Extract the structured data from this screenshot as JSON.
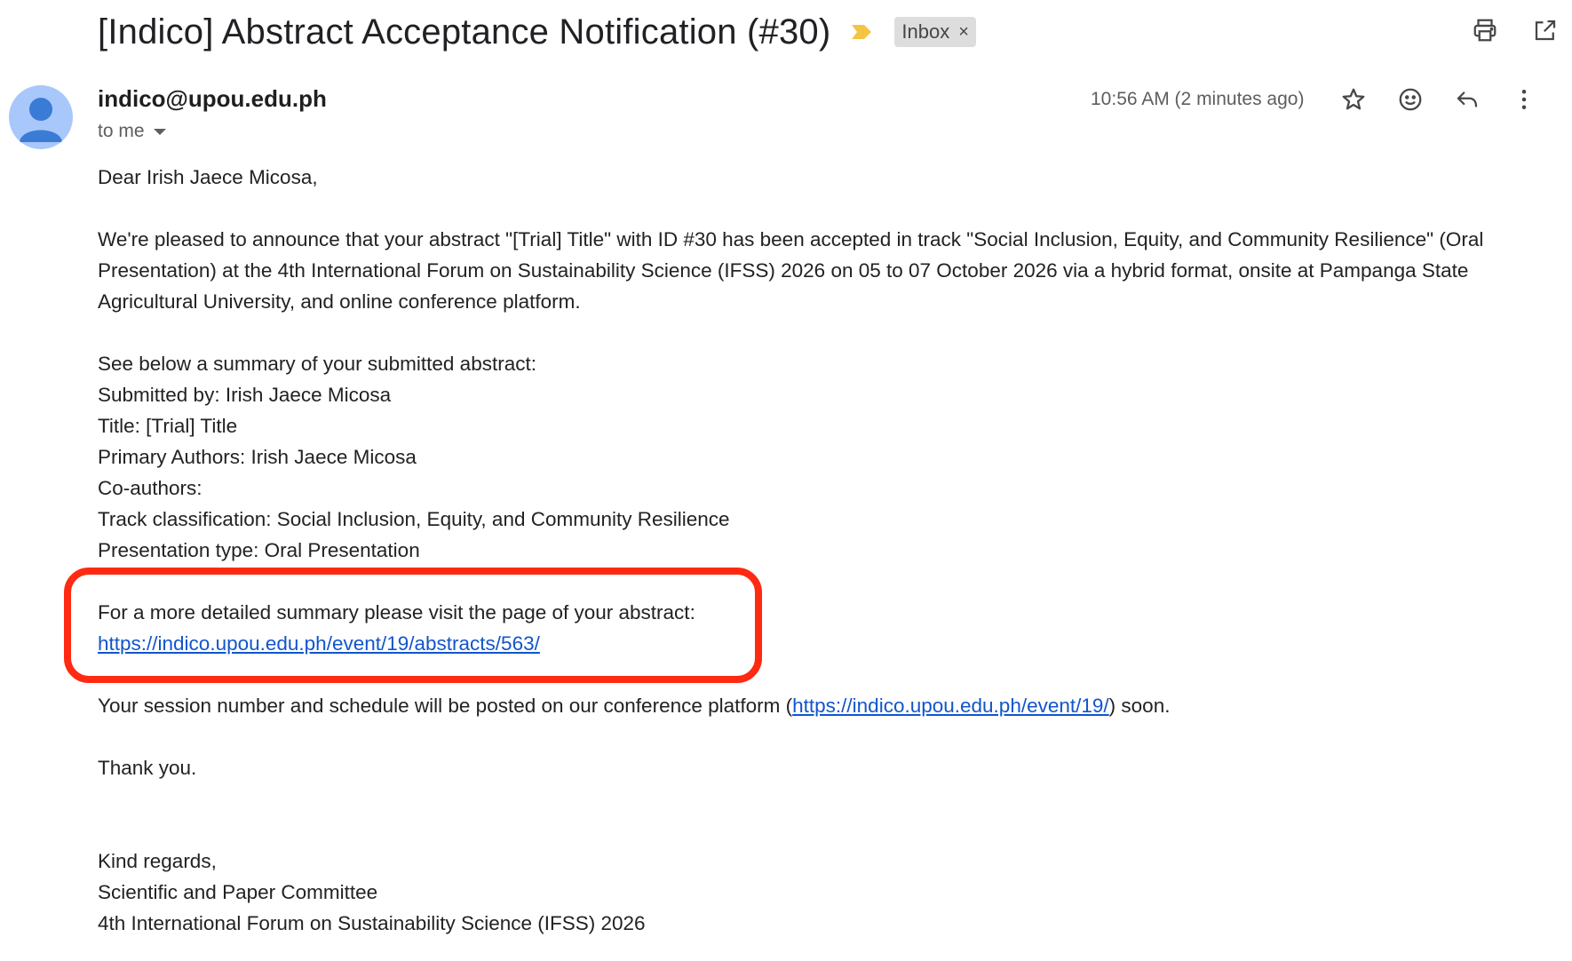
{
  "email": {
    "subject": "[Indico] Abstract Acceptance Notification (#30)",
    "label": "Inbox",
    "label_close": "×",
    "sender": "indico@upou.edu.ph",
    "recipient_line": "to me",
    "timestamp": "10:56 AM (2 minutes ago)"
  },
  "icons": {
    "importance": "importance-marker-icon",
    "print": "print-icon",
    "open_new_window": "open-in-new-window-icon",
    "star": "star-icon",
    "emoji": "emoji-reaction-icon",
    "reply": "reply-icon",
    "more": "more-vertical-icon",
    "avatar": "default-avatar-icon"
  },
  "colors": {
    "importance": "#f4c542",
    "highlight": "#ff2a12",
    "link": "#1155cc",
    "avatar_bg": "#a8c7fa",
    "avatar_fg": "#3a7bd5",
    "chip_bg": "#dddddd"
  },
  "body": {
    "greeting": "Dear Irish Jaece Micosa,",
    "intro": "We're pleased to announce that your abstract \"[Trial] Title\" with ID #30 has been accepted in track \"Social Inclusion, Equity, and Community Resilience\" (Oral Presentation) at the 4th International Forum on Sustainability Science (IFSS) 2026 on 05 to 07 October 2026 via a hybrid format, onsite at Pampanga State Agricultural University, and online conference platform.",
    "summary_heading": "See below a summary of your submitted abstract:",
    "summary_lines": [
      "Submitted by: Irish Jaece Micosa",
      "Title: [Trial] Title",
      "Primary Authors: Irish Jaece Micosa",
      "Co-authors:",
      "Track classification: Social Inclusion, Equity, and Community Resilience",
      "Presentation type: Oral Presentation"
    ],
    "detail_text": "For a more detailed summary please visit the page of your abstract:",
    "detail_link": "https://indico.upou.edu.ph/event/19/abstracts/563/",
    "session_text_before": "Your session number and schedule will be posted on our conference platform (",
    "session_link": "https://indico.upou.edu.ph/event/19/",
    "session_text_after": ") soon.",
    "thanks": "Thank you.",
    "signoff": "Kind regards,",
    "committee": "Scientific and Paper Committee",
    "event": "4th International Forum on Sustainability Science (IFSS) 2026"
  }
}
